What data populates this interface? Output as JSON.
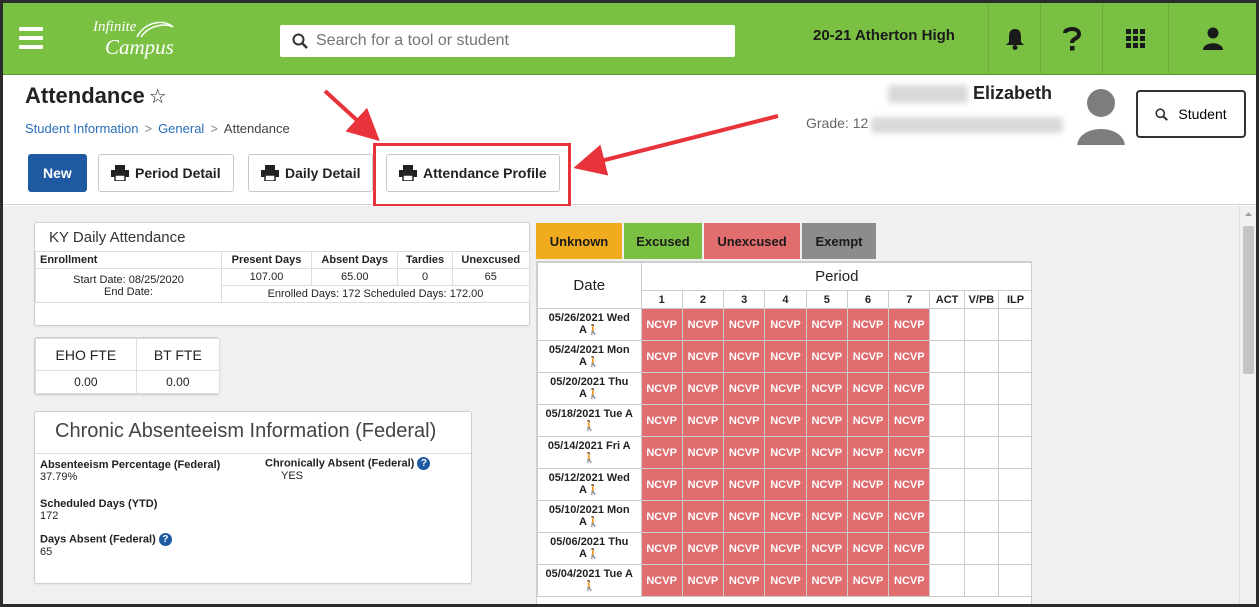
{
  "topbar": {
    "logo_line1": "Infinite",
    "logo_line2": "Campus",
    "search_placeholder": "Search for a tool or student",
    "school_year": "20-21 Atherton High"
  },
  "header": {
    "title": "Attendance",
    "breadcrumbs": [
      "Student Information",
      "General",
      "Attendance"
    ],
    "student_first_name": "Elizabeth",
    "grade": "Grade: 12",
    "student_button": "Student"
  },
  "toolbar": {
    "new": "New",
    "period_detail": "Period Detail",
    "daily_detail": "Daily Detail",
    "attendance_profile": "Attendance Profile"
  },
  "ky": {
    "title": "KY Daily Attendance",
    "enrollment_header": "Enrollment",
    "start_date": "Start Date: 08/25/2020",
    "end_date": "End Date:",
    "columns": [
      "Present Days",
      "Absent Days",
      "Tardies",
      "Unexcused"
    ],
    "values": [
      "107.00",
      "65.00",
      "0",
      "65"
    ],
    "enrolled_line": "Enrolled Days: 172 Scheduled Days: 172.00"
  },
  "fte": {
    "headers": [
      "EHO FTE",
      "BT FTE"
    ],
    "values": [
      "0.00",
      "0.00"
    ]
  },
  "chronic": {
    "title": "Chronic Absenteeism Information (Federal)",
    "absenteeism_label": "Absenteeism Percentage (Federal)",
    "absenteeism_value": "37.79%",
    "chronically_label": "Chronically Absent (Federal)",
    "chronically_value": "YES",
    "scheduled_label": "Scheduled Days (YTD)",
    "scheduled_value": "172",
    "days_absent_label": "Days Absent (Federal)",
    "days_absent_value": "65"
  },
  "legend": {
    "unknown": "Unknown",
    "excused": "Excused",
    "unexcused": "Unexcused",
    "exempt": "Exempt",
    "colors": {
      "unknown": "#f0ac1e",
      "excused": "#7ac143",
      "unexcused": "#e26d6e",
      "exempt": "#8c8c8c"
    }
  },
  "grid": {
    "date_header": "Date",
    "period_header": "Period",
    "period_columns": [
      "1",
      "2",
      "3",
      "4",
      "5",
      "6",
      "7"
    ],
    "extra_columns": [
      "ACT",
      "V/PB",
      "ILP"
    ],
    "cell_code": "NCVP",
    "rows": [
      {
        "date": "05/26/2021 Wed",
        "suffix": "A"
      },
      {
        "date": "05/24/2021 Mon",
        "suffix": "A"
      },
      {
        "date": "05/20/2021 Thu",
        "suffix": "A"
      },
      {
        "date": "05/18/2021 Tue A",
        "suffix": ""
      },
      {
        "date": "05/14/2021 Fri A",
        "suffix": ""
      },
      {
        "date": "05/12/2021 Wed",
        "suffix": "A"
      },
      {
        "date": "05/10/2021 Mon",
        "suffix": "A"
      },
      {
        "date": "05/06/2021 Thu",
        "suffix": "A"
      },
      {
        "date": "05/04/2021 Tue A",
        "suffix": ""
      }
    ]
  }
}
